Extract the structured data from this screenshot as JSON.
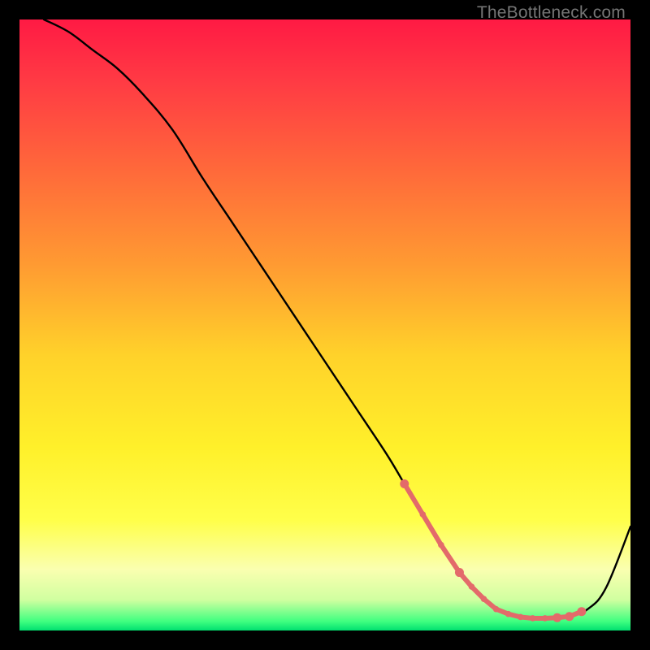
{
  "watermark": "TheBottleneck.com",
  "chart_data": {
    "type": "line",
    "title": "",
    "xlabel": "",
    "ylabel": "",
    "xlim": [
      0,
      100
    ],
    "ylim": [
      0,
      100
    ],
    "background_gradient": {
      "stops": [
        {
          "offset": 0.0,
          "color": "#ff1a44"
        },
        {
          "offset": 0.1,
          "color": "#ff3a44"
        },
        {
          "offset": 0.25,
          "color": "#ff6a3a"
        },
        {
          "offset": 0.4,
          "color": "#ff9a32"
        },
        {
          "offset": 0.55,
          "color": "#ffd22a"
        },
        {
          "offset": 0.7,
          "color": "#fff02a"
        },
        {
          "offset": 0.82,
          "color": "#ffff4a"
        },
        {
          "offset": 0.9,
          "color": "#faffb0"
        },
        {
          "offset": 0.95,
          "color": "#d0ffa0"
        },
        {
          "offset": 0.985,
          "color": "#40ff80"
        },
        {
          "offset": 1.0,
          "color": "#00e070"
        }
      ]
    },
    "series": [
      {
        "name": "bottleneck-curve",
        "color": "#000000",
        "x": [
          4,
          8,
          12,
          16,
          20,
          25,
          30,
          35,
          40,
          45,
          50,
          55,
          60,
          63,
          66,
          69,
          72,
          75,
          78,
          81,
          84,
          87,
          90,
          93,
          96,
          100
        ],
        "y": [
          100,
          98,
          95,
          92,
          88,
          82,
          74,
          66.5,
          59,
          51.5,
          44,
          36.5,
          29,
          24,
          19,
          14,
          9.5,
          6,
          3.5,
          2.3,
          2.0,
          2.0,
          2.3,
          3.5,
          7,
          17
        ]
      }
    ],
    "marker_band": {
      "name": "optimal-range-markers",
      "color": "#e36a6a",
      "x": [
        63,
        66,
        69,
        72,
        74,
        76,
        78,
        80,
        82,
        84,
        86,
        88,
        90,
        92
      ],
      "thick": [
        63,
        72,
        88,
        90,
        92
      ]
    }
  }
}
